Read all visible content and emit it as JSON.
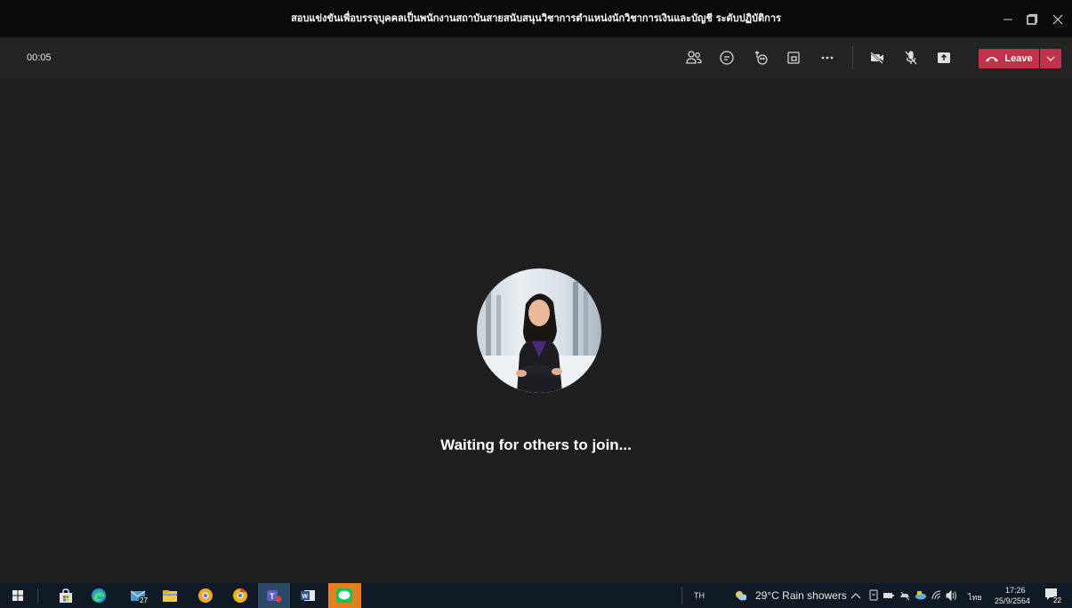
{
  "window": {
    "title": "สอบแข่งขันเพื่อบรรจุบุคคลเป็นพนักงานสถาบันสายสนับสนุนวิชาการตำแหน่งนักวิชาการเงินและบัญชี ระดับปฏิบัติการ"
  },
  "toolbar": {
    "timer": "00:05",
    "icons": [
      "people-icon",
      "chat-icon",
      "reactions-icon",
      "rooms-icon",
      "more-icon",
      "camera-off-icon",
      "mic-off-icon",
      "share-icon"
    ],
    "leave_label": "Leave"
  },
  "stage": {
    "status": "Waiting for others to join..."
  },
  "taskbar": {
    "mail_badge": "27",
    "input_language": "TH",
    "weather": "29°C  Rain showers",
    "keyboard_lang": "ไทย",
    "time": "17:26",
    "date": "25/9/2564",
    "notification_count": "22"
  },
  "colors": {
    "leave": "#c4314b",
    "stage": "#1f1f1f",
    "toolbar": "#242424",
    "titlebar": "#0b0b0b",
    "taskbar": "#0f1a24"
  }
}
